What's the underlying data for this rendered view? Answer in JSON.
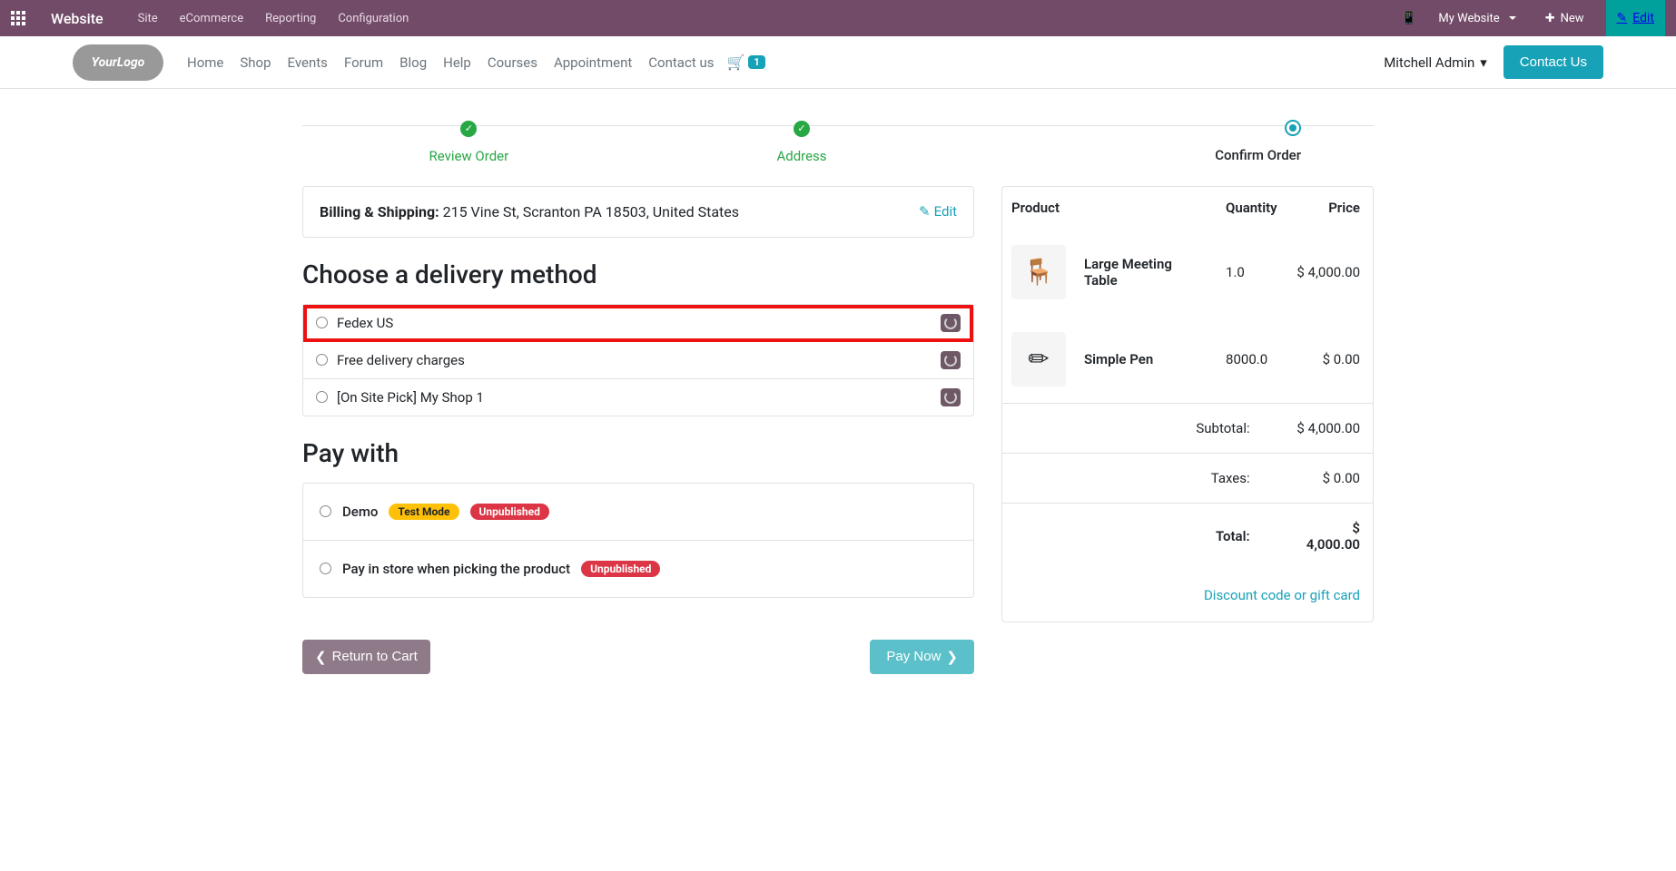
{
  "topbar": {
    "title": "Website",
    "menu": [
      "Site",
      "eCommerce",
      "Reporting",
      "Configuration"
    ],
    "my_website": "My Website",
    "new": "New",
    "edit": "Edit"
  },
  "sitenav": [
    "Home",
    "Shop",
    "Events",
    "Forum",
    "Blog",
    "Help",
    "Courses",
    "Appointment",
    "Contact us"
  ],
  "cart_count": "1",
  "user": "Mitchell Admin",
  "contact_us": "Contact Us",
  "steps": [
    "Review Order",
    "Address",
    "Confirm Order"
  ],
  "address": {
    "label": "Billing & Shipping:",
    "value": "215 Vine St, Scranton PA 18503, United States",
    "edit": "Edit"
  },
  "delivery": {
    "heading": "Choose a delivery method",
    "options": [
      "Fedex US",
      "Free delivery charges",
      "[On Site Pick] My Shop 1"
    ]
  },
  "pay": {
    "heading": "Pay with",
    "options": [
      {
        "name": "Demo",
        "test_mode": "Test Mode",
        "unpublished": "Unpublished"
      },
      {
        "name": "Pay in store when picking the product",
        "unpublished": "Unpublished"
      }
    ]
  },
  "actions": {
    "return": "Return to Cart",
    "pay_now": "Pay Now"
  },
  "summary": {
    "headers": [
      "Product",
      "Quantity",
      "Price"
    ],
    "items": [
      {
        "name": "Large Meeting Table",
        "qty": "1.0",
        "price": "$ 4,000.00",
        "icon": "🪑"
      },
      {
        "name": "Simple Pen",
        "qty": "8000.0",
        "price": "$ 0.00",
        "icon": "✏"
      }
    ],
    "subtotal_label": "Subtotal:",
    "subtotal": "$ 4,000.00",
    "taxes_label": "Taxes:",
    "taxes": "$ 0.00",
    "total_label": "Total:",
    "total": "$ 4,000.00",
    "discount": "Discount code or gift card"
  }
}
